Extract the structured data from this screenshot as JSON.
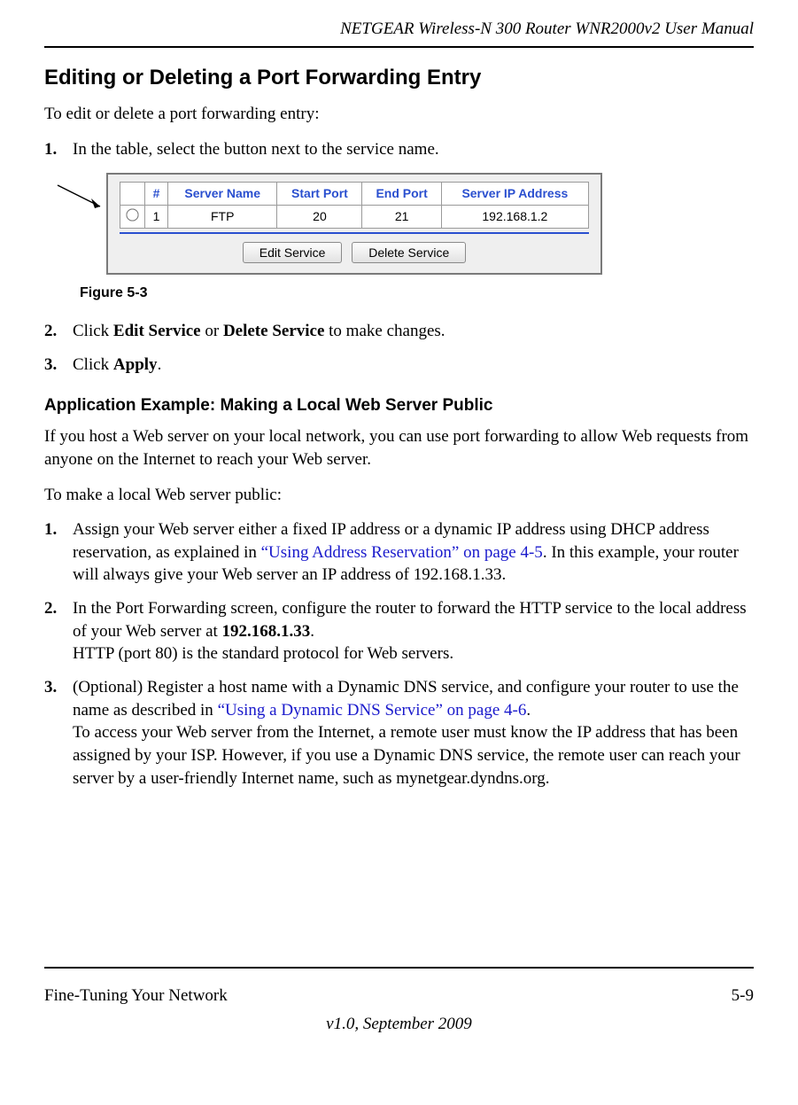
{
  "header": {
    "title": "NETGEAR Wireless-N 300 Router WNR2000v2 User Manual"
  },
  "section": {
    "heading": "Editing or Deleting a Port Forwarding Entry",
    "intro": "To edit or delete a port forwarding entry:",
    "step1": "In the table, select the button next to the service name.",
    "step2_a": "Click ",
    "step2_b": "Edit Service",
    "step2_c": " or ",
    "step2_d": "Delete Service",
    "step2_e": " to make changes.",
    "step3_a": "Click ",
    "step3_b": "Apply",
    "step3_c": "."
  },
  "figure": {
    "caption": "Figure 5-3",
    "headers": {
      "num": "#",
      "name": "Server Name",
      "start": "Start Port",
      "end": "End Port",
      "ip": "Server IP Address"
    },
    "row": {
      "num": "1",
      "name": "FTP",
      "start": "20",
      "end": "21",
      "ip": "192.168.1.2"
    },
    "buttons": {
      "edit": "Edit Service",
      "delete": "Delete Service"
    }
  },
  "subsection": {
    "heading": "Application Example: Making a Local Web Server Public",
    "para1": "If you host a Web server on your local network, you can use port forwarding to allow Web requests from anyone on the Internet to reach your Web server.",
    "para2": "To make a local Web server public:",
    "s1_a": "Assign your Web server either a fixed IP address or a dynamic IP address using DHCP address reservation, as explained in ",
    "s1_link": "“Using Address Reservation” on page 4-5",
    "s1_b": ". In this example, your router will always give your Web server an IP address of 192.168.1.33.",
    "s2_a": "In the Port Forwarding screen, configure the router to forward the HTTP service to the local address of your Web server at ",
    "s2_bold": "192.168.1.33",
    "s2_b": ".",
    "s2_c": "HTTP (port 80) is the standard protocol for Web servers.",
    "s3_a": "(Optional) Register a host name with a Dynamic DNS service, and configure your router to use the name as described in ",
    "s3_link": "“Using a Dynamic DNS Service” on page 4-6",
    "s3_b": ".",
    "s3_c": "To access your Web server from the Internet, a remote user must know the IP address that has been assigned by your ISP. However, if you use a Dynamic DNS service, the remote user can reach your server by a user-friendly Internet name, such as mynetgear.dyndns.org."
  },
  "footer": {
    "left": "Fine-Tuning Your Network",
    "right": "5-9",
    "version": "v1.0, September 2009"
  }
}
